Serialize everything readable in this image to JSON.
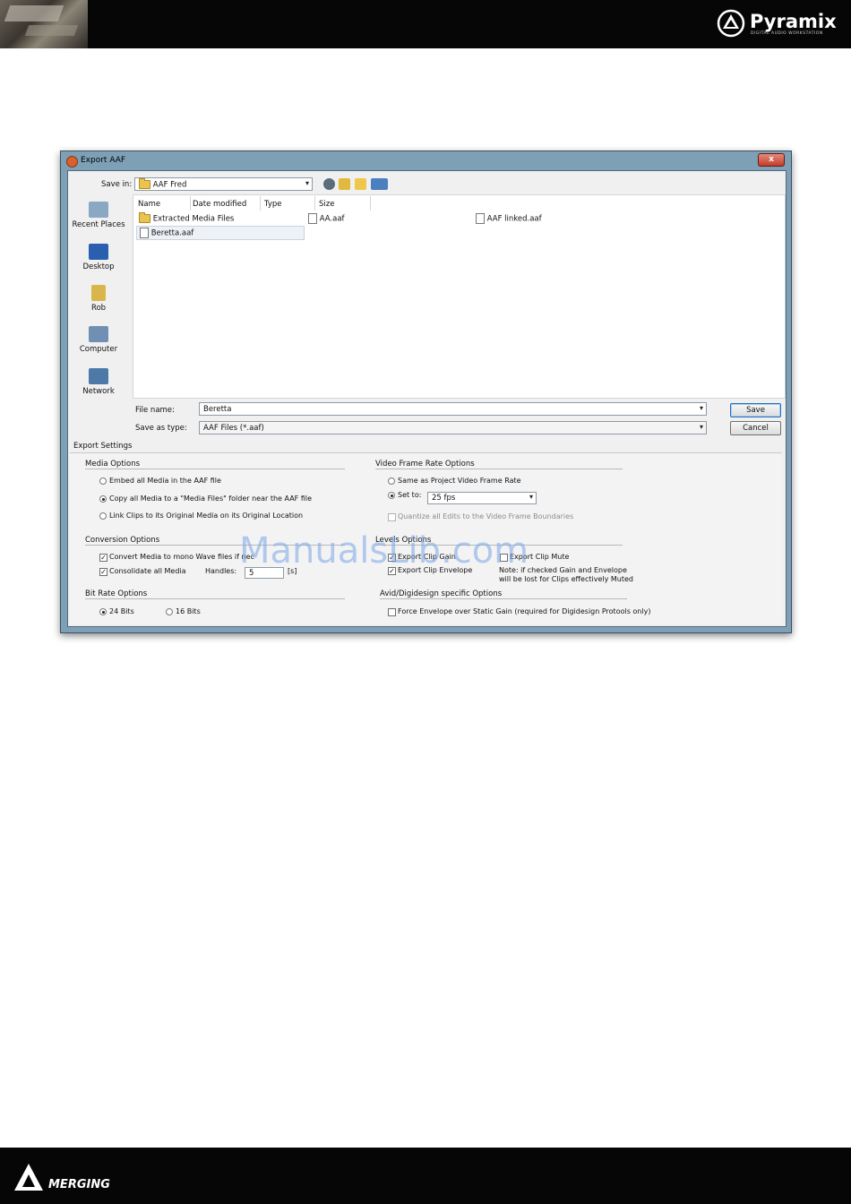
{
  "header": {
    "brand_name": "Pyramix",
    "brand_tagline": "DIGITAL AUDIO WORKSTATION"
  },
  "footer": {
    "brand_name": "MERGING"
  },
  "dialog": {
    "title": "Export AAF",
    "close_glyph": "x",
    "save_in_label": "Save in:",
    "save_in_value": "AAF Fred",
    "places": [
      {
        "label": "Recent Places",
        "icon": "recent-places-icon"
      },
      {
        "label": "Desktop",
        "icon": "desktop-icon"
      },
      {
        "label": "Rob",
        "icon": "user-folder-icon"
      },
      {
        "label": "Computer",
        "icon": "computer-icon"
      },
      {
        "label": "Network",
        "icon": "network-icon"
      }
    ],
    "columns": [
      "Name",
      "Date modified",
      "Type",
      "Size"
    ],
    "files": [
      {
        "name": "Extracted Media Files",
        "kind": "folder"
      },
      {
        "name": "AA.aaf",
        "kind": "file"
      },
      {
        "name": "AAF linked.aaf",
        "kind": "file"
      },
      {
        "name": "Beretta.aaf",
        "kind": "file"
      }
    ],
    "file_name_label": "File name:",
    "file_name_value": "Beretta",
    "save_as_type_label": "Save as type:",
    "save_as_type_value": "AAF Files (*.aaf)",
    "save_button": "Save",
    "cancel_button": "Cancel"
  },
  "settings": {
    "title": "Export Settings",
    "media_options": {
      "title": "Media Options",
      "options": [
        {
          "label": "Embed all Media in the AAF file",
          "selected": false
        },
        {
          "label": "Copy all Media to a \"Media Files\" folder near the AAF file",
          "selected": true
        },
        {
          "label": "Link Clips to its Original Media on its Original Location",
          "selected": false
        }
      ]
    },
    "video_frame_rate": {
      "title": "Video Frame Rate Options",
      "same_as_project": "Same as Project Video Frame Rate",
      "set_to_label": "Set to:",
      "set_to_value": "25 fps",
      "quantize": "Quantize all Edits to the Video Frame Boundaries",
      "selected": "set_to"
    },
    "conversion_options": {
      "title": "Conversion Options",
      "convert_mono": "Convert Media to mono Wave files if nec",
      "convert_mono_checked": true,
      "consolidate": "Consolidate all Media",
      "consolidate_checked": true,
      "handles_label": "Handles:",
      "handles_value": "5",
      "handles_unit": "[s]"
    },
    "levels_options": {
      "title": "Levels Options",
      "export_clip_gain": "Export Clip Gain",
      "export_clip_gain_checked": true,
      "export_clip_envelope": "Export Clip Envelope",
      "export_clip_envelope_checked": true,
      "export_clip_mute": "Export Clip Mute",
      "export_clip_mute_checked": false,
      "note_line1": "Note: if checked Gain and Envelope",
      "note_line2": "will be lost for Clips effectively Muted"
    },
    "bit_rate_options": {
      "title": "Bit Rate Options",
      "options": [
        {
          "label": "24 Bits",
          "selected": true
        },
        {
          "label": "16 Bits",
          "selected": false
        }
      ]
    },
    "avid_options": {
      "title": "Avid/Digidesign specific Options",
      "force_envelope": "Force Envelope over Static Gain (required for Digidesign Protools only)",
      "force_envelope_checked": false
    }
  },
  "watermark": "ManualsLib.com"
}
